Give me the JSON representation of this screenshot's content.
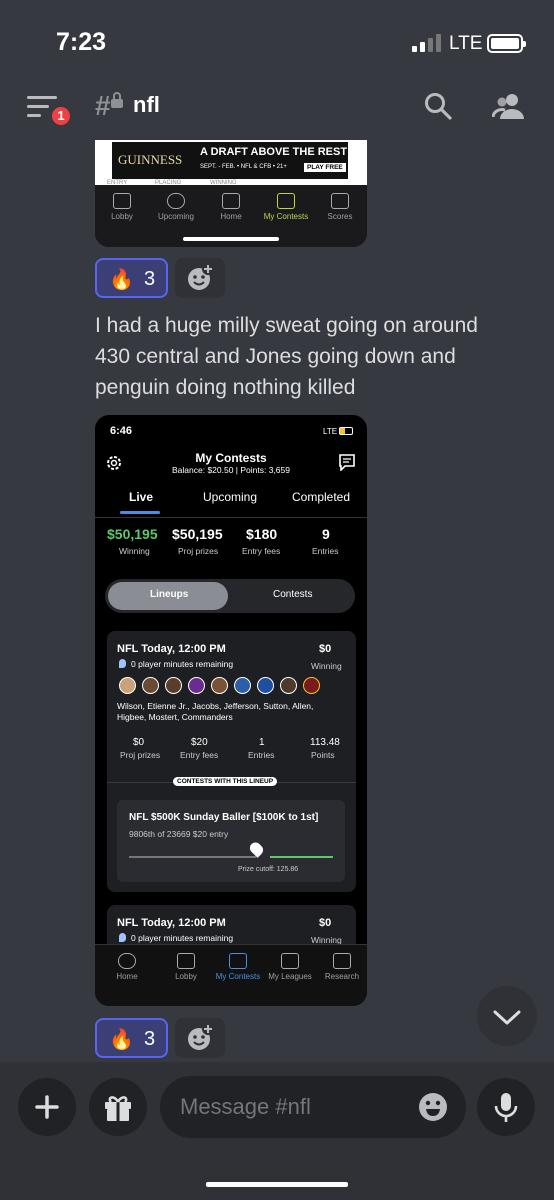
{
  "status_bar": {
    "time": "7:23",
    "network": "LTE"
  },
  "header": {
    "notification_count": "1",
    "channel_name": "nfl"
  },
  "image1": {
    "ad_brand": "GUINNESS",
    "ad_headline": "A DRAFT ABOVE THE REST",
    "ad_sub": "SEPT. - FEB. • NFL & CFB • 21+",
    "ad_cta": "PLAY FREE",
    "col_labels": [
      "ENTRY",
      "PLACING",
      "WINNING"
    ],
    "nav": [
      "Lobby",
      "Upcoming",
      "Home",
      "My Contests",
      "Scores"
    ]
  },
  "reaction1": {
    "emoji": "🔥",
    "count": "3"
  },
  "message": {
    "text": "I had a huge milly sweat going on around 430 central and Jones going down and penguin doing nothing killed"
  },
  "image2": {
    "time": "6:46",
    "network": "LTE",
    "title": "My Contests",
    "balance_line": "Balance: $20.50  |  Points: 3,659",
    "tabs": [
      "Live",
      "Upcoming",
      "Completed"
    ],
    "stats": [
      {
        "value": "$50,195",
        "label": "Winning"
      },
      {
        "value": "$50,195",
        "label": "Proj prizes"
      },
      {
        "value": "$180",
        "label": "Entry fees"
      },
      {
        "value": "9",
        "label": "Entries"
      }
    ],
    "toggle": [
      "Lineups",
      "Contests"
    ],
    "card1": {
      "title": "NFL Today, 12:00 PM",
      "remaining": "0 player minutes remaining",
      "winning_value": "$0",
      "winning_label": "Winning",
      "players_line1": "Wilson, Etienne Jr., Jacobs, Jefferson, Sutton, Allen,",
      "players_line2": "Higbee, Mostert, Commanders",
      "stats": [
        {
          "value": "$0",
          "label": "Proj prizes"
        },
        {
          "value": "$20",
          "label": "Entry fees"
        },
        {
          "value": "1",
          "label": "Entries"
        },
        {
          "value": "113.48",
          "label": "Points"
        }
      ],
      "section_label": "CONTESTS WITH THIS LINEUP",
      "contest_name": "NFL $500K Sunday Baller [$100K to 1st]",
      "contest_place": "9806th of 23669   $20 entry",
      "prize_cutoff": "Prize cutoff: 125.86"
    },
    "card2": {
      "title": "NFL Today, 12:00 PM",
      "remaining": "0 player minutes remaining",
      "winning_value": "$0",
      "winning_label": "Winning"
    },
    "nav": [
      "Home",
      "Lobby",
      "My Contests",
      "My Leagues",
      "Research"
    ]
  },
  "reaction2": {
    "emoji": "🔥",
    "count": "3"
  },
  "composer": {
    "placeholder": "Message #nfl"
  },
  "colors": {
    "accent": "#5865f2",
    "green": "#5fc86b",
    "badge": "#ed4245"
  }
}
